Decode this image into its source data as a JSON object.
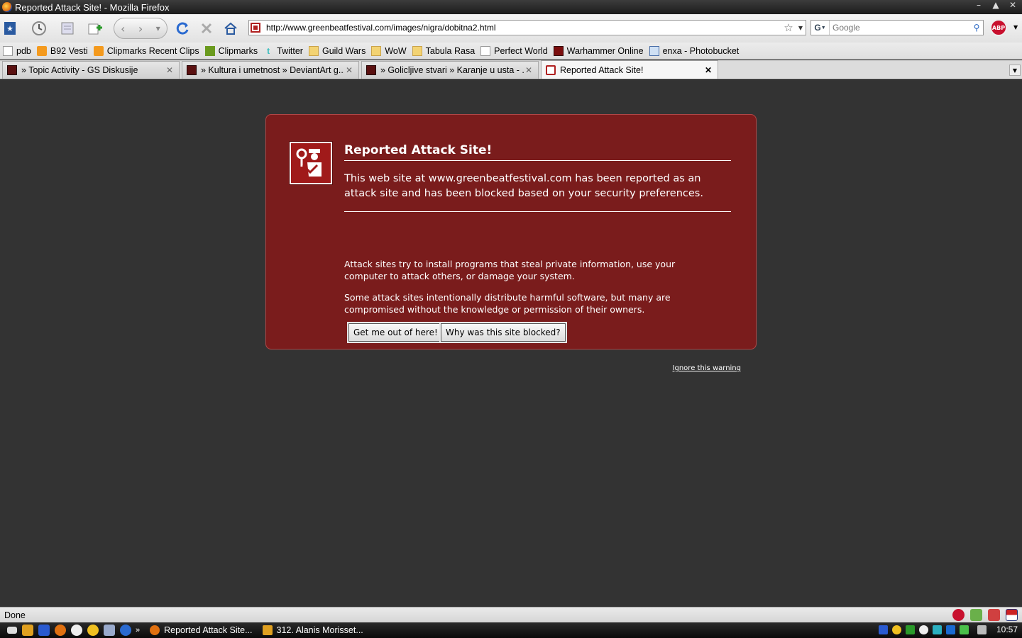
{
  "window": {
    "title": "Reported Attack Site! - Mozilla Firefox",
    "controls": [
      "–",
      "▲",
      "✕"
    ]
  },
  "navbar": {
    "url": "http://www.greenbeatfestival.com/images/nigra/dobitna2.html",
    "search_engine_glyph": "G",
    "search_placeholder": "Google",
    "abp_label": "ABP"
  },
  "bookmarks": [
    {
      "label": "pdb",
      "icon": "page"
    },
    {
      "label": "B92 Vesti",
      "icon": "rss"
    },
    {
      "label": "Clipmarks Recent Clips",
      "icon": "rss"
    },
    {
      "label": "Clipmarks",
      "icon": "clip"
    },
    {
      "label": "Twitter",
      "icon": "twit"
    },
    {
      "label": "Guild Wars",
      "icon": "folder"
    },
    {
      "label": "WoW",
      "icon": "folder"
    },
    {
      "label": "Tabula Rasa",
      "icon": "folder"
    },
    {
      "label": "Perfect World",
      "icon": "page"
    },
    {
      "label": "Warhammer Online",
      "icon": "warh"
    },
    {
      "label": "enxa - Photobucket",
      "icon": "photo"
    }
  ],
  "tabs": [
    {
      "label": "» Topic Activity - GS Diskusije",
      "active": false
    },
    {
      "label": "» Kultura i umetnost » DeviantArt g...",
      "active": false
    },
    {
      "label": "» Golicljive stvari » Karanje u usta - ...",
      "active": false
    },
    {
      "label": "Reported Attack Site!",
      "active": true
    }
  ],
  "error_page": {
    "title": "Reported Attack Site!",
    "short_desc": "This web site at www.greenbeatfestival.com has been reported as an attack site and has been blocked based on your security preferences.",
    "long_desc_1": "Attack sites try to install programs that steal private information, use your computer to attack others, or damage your system.",
    "long_desc_2": "Some attack sites intentionally distribute harmful software, but many are compromised without the knowledge or permission of their owners.",
    "button_escape": "Get me out of here!",
    "button_why": "Why was this site blocked?",
    "ignore_link": "Ignore this warning",
    "colors": {
      "box": "#7a1c1c",
      "background": "#333333"
    }
  },
  "statusbar": {
    "text": "Done"
  },
  "taskbar": {
    "items": [
      {
        "label": "Reported Attack Site..."
      },
      {
        "label": "312. Alanis Morisset..."
      }
    ],
    "clock": "10:57"
  }
}
